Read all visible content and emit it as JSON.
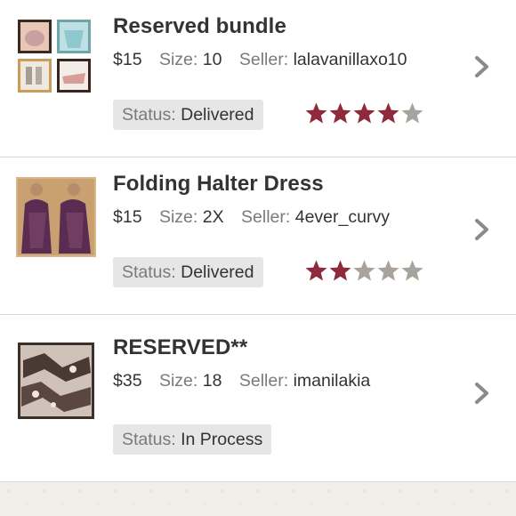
{
  "orders": [
    {
      "title": "Reserved bundle",
      "price": "$15",
      "size_label": "Size:",
      "size": "10",
      "seller_label": "Seller:",
      "seller": "lalavanillaxo10",
      "status_label": "Status:",
      "status": "Delivered",
      "rating": 4,
      "rating_max": 5,
      "thumbnail": "bundle-collage"
    },
    {
      "title": "Folding Halter Dress",
      "price": "$15",
      "size_label": "Size:",
      "size": "2X",
      "seller_label": "Seller:",
      "seller": "4ever_curvy",
      "status_label": "Status:",
      "status": "Delivered",
      "rating": 2,
      "rating_max": 5,
      "thumbnail": "purple-halter-dress"
    },
    {
      "title": "RESERVED**",
      "price": "$35",
      "size_label": "Size:",
      "size": "18",
      "seller_label": "Seller:",
      "seller": "imanilakia",
      "status_label": "Status:",
      "status": "In Process",
      "rating": null,
      "thumbnail": "patterned-fabric"
    }
  ],
  "colors": {
    "star_filled": "#8e2a3c",
    "star_empty": "#a8a39d",
    "status_bg": "#e6e6e6",
    "chevron": "#8a8a8a"
  },
  "icons": {
    "chevron": "chevron-right-icon",
    "star": "star-icon"
  }
}
